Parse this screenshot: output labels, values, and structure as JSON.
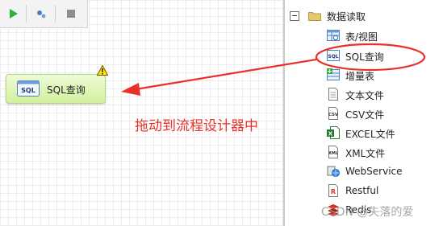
{
  "toolbar": {
    "buttons": [
      "play-icon",
      "settings-icon",
      "stop-icon"
    ]
  },
  "node": {
    "icon_text": "SQL",
    "label": "SQL查询"
  },
  "hint": {
    "text": "拖动到流程设计器中"
  },
  "tree": {
    "group": "数据读取",
    "items": [
      {
        "label": "表/视图",
        "icon": "table-view-icon"
      },
      {
        "label": "SQL查询",
        "icon": "sql-icon",
        "icon_text": "SQL"
      },
      {
        "label": "增量表",
        "icon": "incremental-table-icon"
      },
      {
        "label": "文本文件",
        "icon": "text-file-icon"
      },
      {
        "label": "CSV文件",
        "icon": "csv-file-icon",
        "icon_text": "CSV"
      },
      {
        "label": "EXCEL文件",
        "icon": "excel-file-icon",
        "icon_text": "X"
      },
      {
        "label": "XML文件",
        "icon": "xml-file-icon",
        "icon_text": "XML"
      },
      {
        "label": "WebService",
        "icon": "webservice-icon"
      },
      {
        "label": "Restful",
        "icon": "restful-icon",
        "icon_text": "R"
      },
      {
        "label": "Redis",
        "icon": "redis-icon"
      }
    ]
  },
  "watermark": "CSDN @失落的爱",
  "colors": {
    "accent_red": "#e8312a",
    "node_green": "#d3f19c"
  }
}
